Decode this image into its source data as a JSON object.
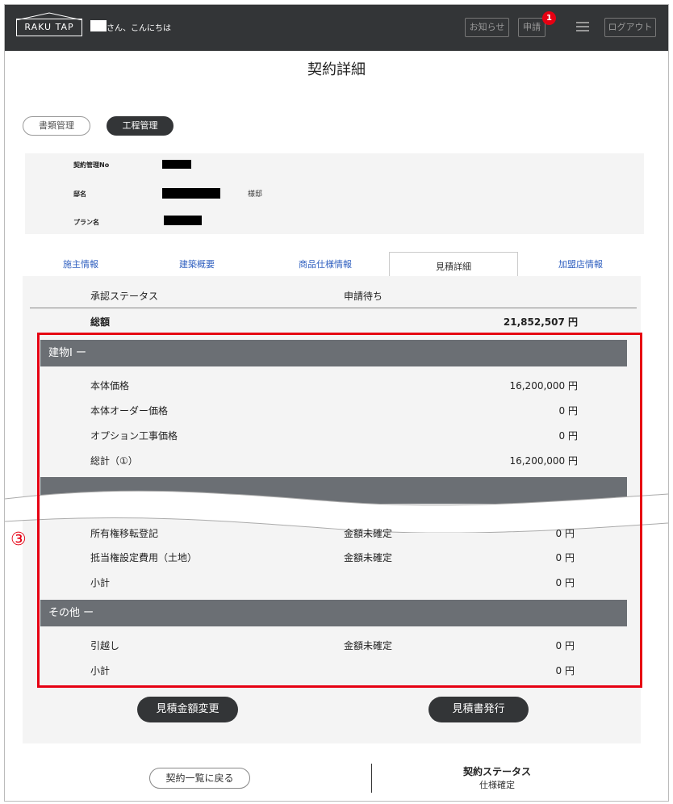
{
  "header": {
    "logo": "RAKU TAP",
    "greeting": "さん、こんにちは",
    "notice_label": "お知らせ",
    "apply_label": "申請",
    "apply_badge": "1",
    "logout_label": "ログアウト"
  },
  "page_title": "契約詳細",
  "pill_tabs": [
    "書類管理",
    "工程管理"
  ],
  "info": {
    "contract_no_label": "契約管理No",
    "owner_label": "邸名",
    "owner_suffix": "様邸",
    "plan_label": "プラン名"
  },
  "tabs": [
    "施主情報",
    "建築概要",
    "商品仕様情報",
    "見積詳細",
    "加盟店情報"
  ],
  "status": {
    "label": "承認ステータス",
    "value": "申請待ち"
  },
  "total": {
    "label": "総額",
    "value": "21,852,507 円"
  },
  "section_building": {
    "title": "建物Ⅰ  ー",
    "rows": [
      {
        "label": "本体価格",
        "value": "16,200,000 円"
      },
      {
        "label": "本体オーダー価格",
        "value": "0 円"
      },
      {
        "label": "オプション工事価格",
        "value": "0 円"
      },
      {
        "label": "総計（①）",
        "value": "16,200,000 円"
      }
    ]
  },
  "section_land": {
    "rows": [
      {
        "label": "所有権移転登記",
        "status": "金額未確定",
        "value": "0 円"
      },
      {
        "label": "抵当権設定費用（土地）",
        "status": "金額未確定",
        "value": "0 円"
      },
      {
        "label": "小計",
        "status": "",
        "value": "0 円"
      }
    ]
  },
  "section_other": {
    "title": "その他  ー",
    "rows": [
      {
        "label": "引越し",
        "status": "金額未確定",
        "value": "0 円"
      },
      {
        "label": "小計",
        "status": "",
        "value": "0 円"
      }
    ]
  },
  "annotation_marker": "③",
  "buttons": {
    "change_estimate": "見積金額変更",
    "issue_estimate": "見積書発行",
    "back_to_list": "契約一覧に戻る"
  },
  "contract_status": {
    "label": "契約ステータス",
    "value": "仕様確定"
  },
  "colors": {
    "header_bg": "#333537",
    "accent_red": "#e60012",
    "tab_link": "#3060c0",
    "section_bar": "#6b6f74"
  }
}
